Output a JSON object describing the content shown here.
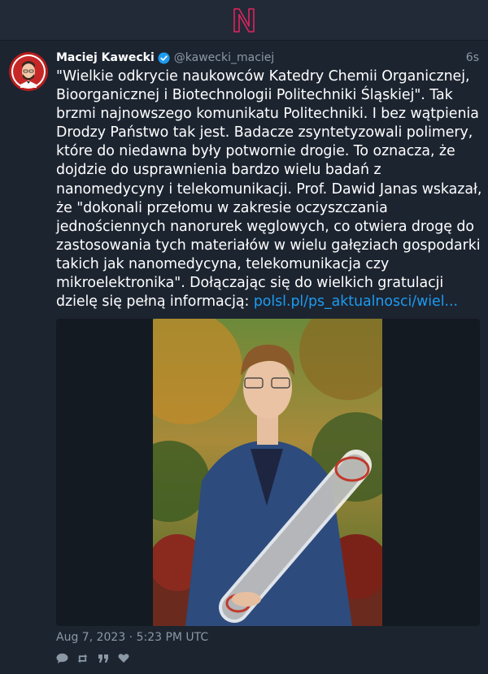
{
  "app": {
    "logo_icon": "n-logo-icon",
    "accent": "#e0245e",
    "link_color": "#1d9bf0"
  },
  "tweet": {
    "author": {
      "name": "Maciej Kawecki",
      "handle": "@kawecki_maciej",
      "verified": true
    },
    "time_ago": "6s",
    "text_main": "\"Wielkie odkrycie naukowców Katedry Chemii Organicznej, Bioorganicznej i Biotechnologii Politechniki Śląskiej\". Tak brzmi najnowszego komunikatu Politechniki. I bez wątpienia Drodzy Państwo tak jest. Badacze zsyntetyzowali polimery, które do niedawna były potwornie drogie. To oznacza, że dojdzie do usprawnienia bardzo wielu badań z nanomedycyny i telekomunikacji. Prof. Dawid Janas wskazał, że \"dokonali przełomu w zakresie oczyszczania jednościennych nanorurek węglowych, co otwiera drogę do zastosowania tych materiałów w wielu gałęziach gospodarki takich jak nanomedycyna, telekomunikacja czy mikroelektronika\". Dołączając się do wielkich gratulacji dzielę się pełną informacją: ",
    "link_text": "polsl.pl/ps_aktualnosci/wiel...",
    "timestamp": "Aug 7, 2023 · 5:23 PM UTC",
    "actions": [
      "reply-icon",
      "retweet-icon",
      "quote-icon",
      "like-icon"
    ]
  }
}
